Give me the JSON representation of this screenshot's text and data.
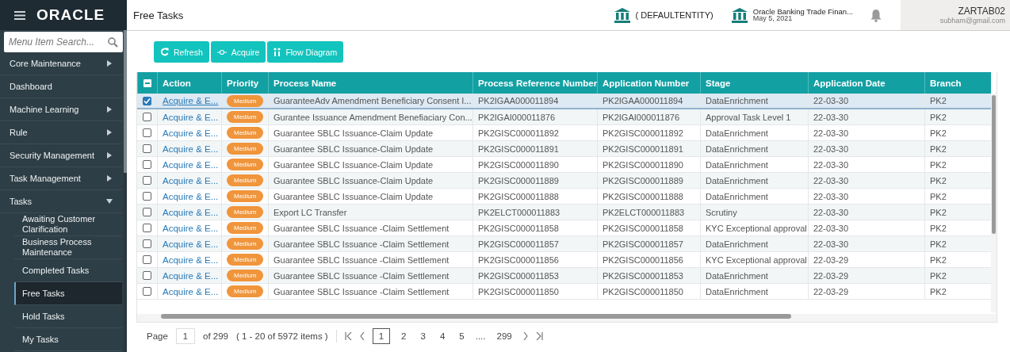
{
  "sidebar": {
    "logo": "ORACLE",
    "search": {
      "placeholder": "Menu Item Search..."
    },
    "items": [
      {
        "label": "Core Maintenance",
        "kind": "menu",
        "expanded": false
      },
      {
        "label": "Dashboard",
        "kind": "link"
      },
      {
        "label": "Machine Learning",
        "kind": "menu",
        "expanded": false
      },
      {
        "label": "Rule",
        "kind": "menu",
        "expanded": false
      },
      {
        "label": "Security Management",
        "kind": "menu",
        "expanded": false
      },
      {
        "label": "Task Management",
        "kind": "menu",
        "expanded": false
      },
      {
        "label": "Tasks",
        "kind": "menu",
        "expanded": true,
        "children": [
          {
            "label": "Awaiting Customer Clarification",
            "selected": false
          },
          {
            "label": "Business Process Maintenance",
            "selected": false
          },
          {
            "label": "Completed Tasks",
            "selected": false
          },
          {
            "label": "Free Tasks",
            "selected": true
          },
          {
            "label": "Hold Tasks",
            "selected": false
          },
          {
            "label": "My Tasks",
            "selected": false
          }
        ]
      }
    ]
  },
  "header": {
    "page_title": "Free Tasks",
    "entity": "( DEFAULTENTITY)",
    "app": {
      "name": "Oracle Banking Trade Finan...",
      "date": "May 5, 2021"
    },
    "user": {
      "name": "ZARTAB02",
      "email": "subham@gmail.com"
    }
  },
  "toolbar": [
    {
      "label": "Refresh",
      "kind": "refresh"
    },
    {
      "label": "Acquire",
      "kind": "acquire"
    },
    {
      "label": "Flow Diagram",
      "kind": "flow"
    }
  ],
  "table": {
    "header_checkbox_partial": true,
    "columns": [
      "Action",
      "Priority",
      "Process Name",
      "Process Reference Number",
      "Application Number",
      "Stage",
      "Application Date",
      "Branch"
    ],
    "rows": [
      {
        "selected": true,
        "checked": true,
        "action": "Acquire & E...",
        "priority": "Medium",
        "process_name": "GuaranteeAdv Amendment Beneficiary Consent I...",
        "reference": "PK2IGAA000011894",
        "application_number": "PK2IGAA000011894",
        "stage": "DataEnrichment",
        "date": "22-03-30",
        "branch": "PK2"
      },
      {
        "selected": false,
        "checked": false,
        "action": "Acquire & E...",
        "priority": "Medium",
        "process_name": "Gurantee Issuance Amendment Benefiaciary Con...",
        "reference": "PK2IGAI000011876",
        "application_number": "PK2IGAI000011876",
        "stage": "Approval Task Level 1",
        "date": "22-03-30",
        "branch": "PK2"
      },
      {
        "selected": false,
        "checked": false,
        "action": "Acquire & E...",
        "priority": "Medium",
        "process_name": "Guarantee SBLC Issuance-Claim Update",
        "reference": "PK2GISC000011892",
        "application_number": "PK2GISC000011892",
        "stage": "DataEnrichment",
        "date": "22-03-30",
        "branch": "PK2"
      },
      {
        "selected": false,
        "checked": false,
        "action": "Acquire & E...",
        "priority": "Medium",
        "process_name": "Guarantee SBLC Issuance-Claim Update",
        "reference": "PK2GISC000011891",
        "application_number": "PK2GISC000011891",
        "stage": "DataEnrichment",
        "date": "22-03-30",
        "branch": "PK2"
      },
      {
        "selected": false,
        "checked": false,
        "action": "Acquire & E...",
        "priority": "Medium",
        "process_name": "Guarantee SBLC Issuance-Claim Update",
        "reference": "PK2GISC000011890",
        "application_number": "PK2GISC000011890",
        "stage": "DataEnrichment",
        "date": "22-03-30",
        "branch": "PK2"
      },
      {
        "selected": false,
        "checked": false,
        "action": "Acquire & E...",
        "priority": "Medium",
        "process_name": "Guarantee SBLC Issuance-Claim Update",
        "reference": "PK2GISC000011889",
        "application_number": "PK2GISC000011889",
        "stage": "DataEnrichment",
        "date": "22-03-30",
        "branch": "PK2"
      },
      {
        "selected": false,
        "checked": false,
        "action": "Acquire & E...",
        "priority": "Medium",
        "process_name": "Guarantee SBLC Issuance-Claim Update",
        "reference": "PK2GISC000011888",
        "application_number": "PK2GISC000011888",
        "stage": "DataEnrichment",
        "date": "22-03-30",
        "branch": "PK2"
      },
      {
        "selected": false,
        "checked": false,
        "action": "Acquire & E...",
        "priority": "Medium",
        "process_name": "Export LC Transfer",
        "reference": "PK2ELCT000011883",
        "application_number": "PK2ELCT000011883",
        "stage": "Scrutiny",
        "date": "22-03-30",
        "branch": "PK2"
      },
      {
        "selected": false,
        "checked": false,
        "action": "Acquire & E...",
        "priority": "Medium",
        "process_name": "Guarantee SBLC Issuance -Claim Settlement",
        "reference": "PK2GISC000011858",
        "application_number": "PK2GISC000011858",
        "stage": "KYC Exceptional approval",
        "date": "22-03-30",
        "branch": "PK2"
      },
      {
        "selected": false,
        "checked": false,
        "action": "Acquire & E...",
        "priority": "Medium",
        "process_name": "Guarantee SBLC Issuance -Claim Settlement",
        "reference": "PK2GISC000011857",
        "application_number": "PK2GISC000011857",
        "stage": "DataEnrichment",
        "date": "22-03-30",
        "branch": "PK2"
      },
      {
        "selected": false,
        "checked": false,
        "action": "Acquire & E...",
        "priority": "Medium",
        "process_name": "Guarantee SBLC Issuance -Claim Settlement",
        "reference": "PK2GISC000011856",
        "application_number": "PK2GISC000011856",
        "stage": "KYC Exceptional approval",
        "date": "22-03-29",
        "branch": "PK2"
      },
      {
        "selected": false,
        "checked": false,
        "action": "Acquire & E...",
        "priority": "Medium",
        "process_name": "Guarantee SBLC Issuance -Claim Settlement",
        "reference": "PK2GISC000011853",
        "application_number": "PK2GISC000011853",
        "stage": "DataEnrichment",
        "date": "22-03-29",
        "branch": "PK2"
      },
      {
        "selected": false,
        "checked": false,
        "action": "Acquire & E...",
        "priority": "Medium",
        "process_name": "Guarantee SBLC Issuance -Claim Settlement",
        "reference": "PK2GISC000011850",
        "application_number": "PK2GISC000011850",
        "stage": "DataEnrichment",
        "date": "22-03-29",
        "branch": "PK2"
      }
    ]
  },
  "pagination": {
    "label": "Page",
    "page": "1",
    "of": "of 299",
    "range": "( 1 - 20 of 5972 items )",
    "pages": [
      {
        "label": "1",
        "kind": "page",
        "selected": true
      },
      {
        "label": "2",
        "kind": "page",
        "selected": false
      },
      {
        "label": "3",
        "kind": "page",
        "selected": false
      },
      {
        "label": "4",
        "kind": "page",
        "selected": false
      },
      {
        "label": "5",
        "kind": "page",
        "selected": false
      },
      {
        "label": "....",
        "kind": "gap"
      },
      {
        "label": "299",
        "kind": "page",
        "selected": false
      }
    ]
  }
}
